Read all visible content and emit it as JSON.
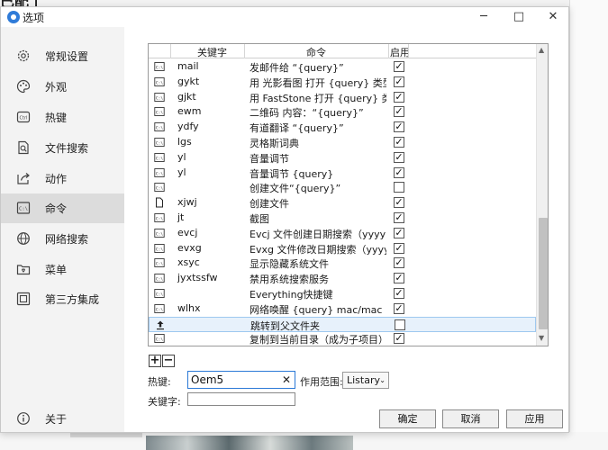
{
  "window": {
    "title": "选项"
  },
  "sidebar": {
    "items": [
      {
        "label": "常规设置",
        "icon": "gear-icon"
      },
      {
        "label": "外观",
        "icon": "palette-icon"
      },
      {
        "label": "热键",
        "icon": "keyboard-icon"
      },
      {
        "label": "文件搜索",
        "icon": "file-search-icon"
      },
      {
        "label": "动作",
        "icon": "share-action-icon"
      },
      {
        "label": "命令",
        "icon": "command-icon",
        "active": true
      },
      {
        "label": "网络搜索",
        "icon": "globe-icon"
      },
      {
        "label": "菜单",
        "icon": "menu-icon"
      },
      {
        "label": "第三方集成",
        "icon": "integration-icon"
      }
    ],
    "about": {
      "label": "关于",
      "icon": "info-icon"
    }
  },
  "table": {
    "headers": {
      "keyword": "关键字",
      "command": "命令",
      "enabled": "启用"
    },
    "rows": [
      {
        "icon": "command-row-icon",
        "keyword": "mail",
        "command": "发邮件给 “{query}”",
        "enabled": true
      },
      {
        "icon": "command-row-icon",
        "keyword": "gykt",
        "command": "用 光影看图 打开 {query} 类型文件",
        "enabled": true
      },
      {
        "icon": "command-row-icon",
        "keyword": "gjkt",
        "command": "用 FastStone 打开 {query} 类型文件",
        "enabled": true
      },
      {
        "icon": "command-row-icon",
        "keyword": "ewm",
        "command": "二维码 内容：“{query}”",
        "enabled": true
      },
      {
        "icon": "command-row-icon",
        "keyword": "ydfy",
        "command": "有道翻译 “{query}”",
        "enabled": true
      },
      {
        "icon": "command-row-icon",
        "keyword": "lgs",
        "command": "灵格斯词典",
        "enabled": true
      },
      {
        "icon": "command-row-icon",
        "keyword": "yl",
        "command": "音量调节",
        "enabled": true
      },
      {
        "icon": "command-row-icon",
        "keyword": "yl",
        "command": "音量调节 {query}",
        "enabled": true
      },
      {
        "icon": "command-row-icon",
        "keyword": "",
        "command": "创建文件“{query}”",
        "enabled": false
      },
      {
        "icon": "file-icon",
        "keyword": "xjwj",
        "command": "创建文件",
        "enabled": true
      },
      {
        "icon": "command-row-icon",
        "keyword": "jt",
        "command": "截图",
        "enabled": true
      },
      {
        "icon": "command-row-icon",
        "keyword": "evcj",
        "command": "Evcj 文件创建日期搜索（yyyymmdd",
        "enabled": true
      },
      {
        "icon": "command-row-icon",
        "keyword": "evxg",
        "command": "Evxg 文件修改日期搜索（yyyymmdd",
        "enabled": true
      },
      {
        "icon": "command-row-icon",
        "keyword": "xsyc",
        "command": "显示隐藏系统文件",
        "enabled": true
      },
      {
        "icon": "command-row-icon",
        "keyword": "jyxtssfw",
        "command": "禁用系统搜索服务",
        "enabled": true
      },
      {
        "icon": "command-row-icon",
        "keyword": "",
        "command": "Everything快捷键",
        "enabled": true
      },
      {
        "icon": "command-row-icon",
        "keyword": "wlhx",
        "command": "网络唤醒 {query} mac/mac ip port",
        "enabled": true
      },
      {
        "icon": "upload-icon",
        "keyword": "",
        "command": "跳转到父文件夹",
        "enabled": false,
        "selected": true
      },
      {
        "icon": "command-row-icon",
        "keyword": "",
        "command": "复制到当前目录（成为子项目）",
        "enabled": true
      }
    ]
  },
  "buttons": {
    "add": "+",
    "remove": "−",
    "ok": "确定",
    "cancel": "取消",
    "apply": "应用"
  },
  "form": {
    "hotkey_label": "热键:",
    "hotkey_value": "Oem5",
    "scope_label": "作用范围:",
    "scope_value": "Listary",
    "keyword_label": "关键字:",
    "keyword_value": ""
  },
  "background": {
    "corner_text": "已配了"
  }
}
